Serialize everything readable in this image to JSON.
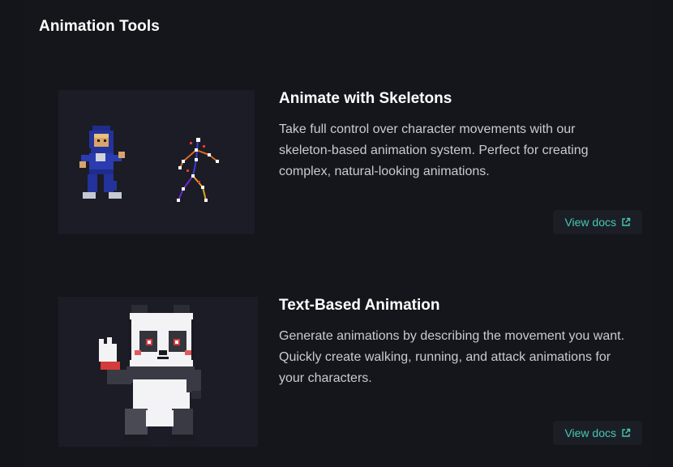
{
  "section": {
    "title": "Animation Tools"
  },
  "cards": [
    {
      "title": "Animate with Skeletons",
      "description": "Take full control over character movements with our skeleton-based animation system. Perfect for creating complex, natural-looking animations.",
      "link_label": "View docs",
      "link_icon": "external-link-icon"
    },
    {
      "title": "Text-Based Animation",
      "description": "Generate animations by describing the movement you want. Quickly create walking, running, and attack animations for your characters.",
      "link_label": "View docs",
      "link_icon": "external-link-icon"
    }
  ],
  "colors": {
    "background": "#14151b",
    "thumbnail": "#1b1c25",
    "accent": "#45c8b4",
    "title": "#ffffff",
    "body_text": "#c9cbd1"
  }
}
